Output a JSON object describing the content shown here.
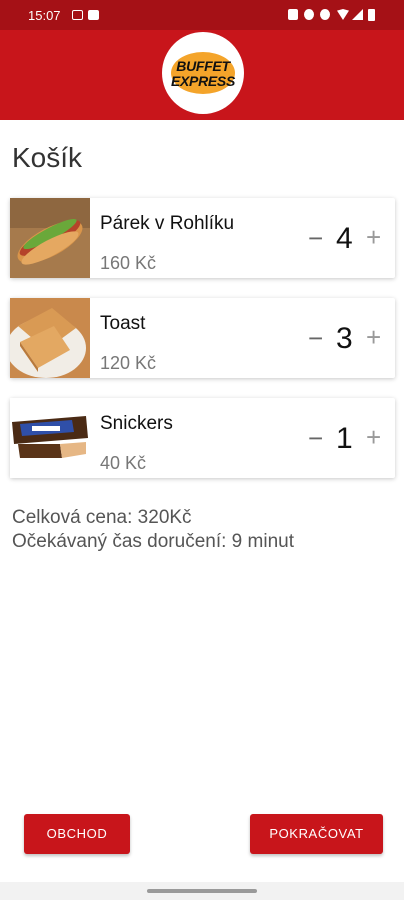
{
  "status_bar": {
    "time": "15:07"
  },
  "header": {
    "logo": {
      "line1": "BUFFET",
      "line2": "EXPRESS"
    }
  },
  "page": {
    "title": "Košík"
  },
  "cart": {
    "items": [
      {
        "name": "Párek v Rohlíku",
        "price": "160 Kč",
        "quantity": "4",
        "minus": "−",
        "plus": "+"
      },
      {
        "name": "Toast",
        "price": "120 Kč",
        "quantity": "3",
        "minus": "−",
        "plus": "+"
      },
      {
        "name": "Snickers",
        "price": "40 Kč",
        "quantity": "1",
        "minus": "−",
        "plus": "+"
      }
    ]
  },
  "summary": {
    "total": "Celková cena: 320Kč",
    "delivery": "Očekávaný čas doručení: 9 minut"
  },
  "buttons": {
    "left": "OBCHOD",
    "right": "POKRAČOVAT"
  },
  "colors": {
    "brand_red": "#c8151b",
    "status_bar": "#a51116",
    "logo_orange": "#f4a42a"
  }
}
